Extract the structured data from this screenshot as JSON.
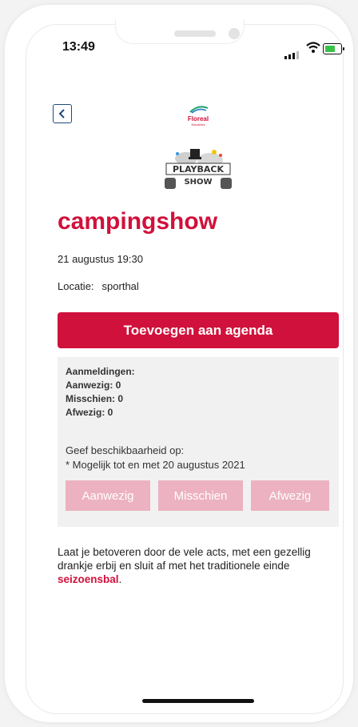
{
  "status_bar": {
    "time": "13:49"
  },
  "header": {
    "back_icon": "chevron-left-icon",
    "logo_text": "Floreal",
    "logo_sub": "Mozaïeks"
  },
  "event": {
    "image": "playback-show-image",
    "title": "campingshow",
    "date": "21 augustus 19:30",
    "location_label": "Locatie:",
    "location_value": "sporthal",
    "add_to_agenda": "Toevoegen aan agenda",
    "registrations": {
      "heading": "Aanmeldingen:",
      "present": "Aanwezig: 0",
      "maybe": "Misschien: 0",
      "absent": "Afwezig: 0"
    },
    "availability_prompt": "Geef beschikbaarheid op:",
    "availability_deadline": "* Mogelijk tot en met 20 augustus 2021",
    "buttons": {
      "present": "Aanwezig",
      "maybe": "Misschien",
      "absent": "Afwezig"
    },
    "description_text": "Laat je betoveren door de vele acts, met een gezellig drankje erbij en sluit af met het traditionele einde ",
    "description_link": "seizoensbal",
    "description_end": "."
  },
  "colors": {
    "accent": "#d0113b",
    "disabled_button": "#ecb2c1",
    "panel_bg": "#f1f1f1"
  }
}
